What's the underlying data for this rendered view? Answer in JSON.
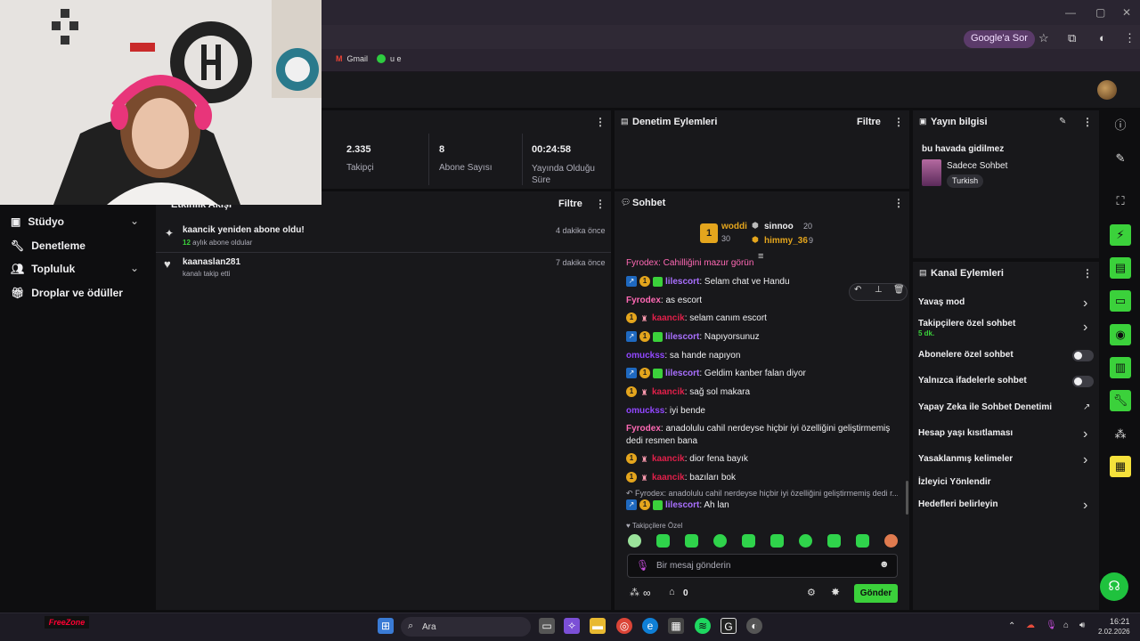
{
  "browser": {
    "ask_google": "Google'a Sor",
    "bookmarks": [
      {
        "label": "Gmail"
      },
      {
        "label": "u e"
      }
    ]
  },
  "nav": {
    "items": [
      {
        "label": "Stüdyo",
        "icon": "studio-icon",
        "has_chevron": true
      },
      {
        "label": "Denetleme",
        "icon": "wrench-icon",
        "has_chevron": false
      },
      {
        "label": "Topluluk",
        "icon": "community-icon",
        "has_chevron": true
      },
      {
        "label": "Droplar ve ödüller",
        "icon": "gift-icon",
        "has_chevron": false
      }
    ]
  },
  "stats": {
    "items": [
      {
        "value": "2.335",
        "label": "Takipçi"
      },
      {
        "value": "8",
        "label": "Abone Sayısı"
      },
      {
        "value": "00:24:58",
        "label": "Yayında Olduğu Süre"
      }
    ]
  },
  "activity": {
    "title": "Etkinlik Akışı",
    "filter": "Filtre",
    "events": [
      {
        "title": "kaancik yeniden abone oldu!",
        "detail_num": "12",
        "detail": " aylık abone oldular",
        "time": "4 dakika önce"
      },
      {
        "title": "kaanaslan281",
        "detail_num": "",
        "detail": "kanalı takip etti",
        "time": "7 dakika önce"
      }
    ]
  },
  "moderation": {
    "title": "Denetim Eylemleri",
    "filter": "Filtre"
  },
  "stream_info": {
    "title": "Yayın bilgisi",
    "stream_title": "bu havada gidilmez",
    "category": "Sadece Sohbet",
    "tag": "Turkish"
  },
  "chat": {
    "title": "Sohbet",
    "leaderboard": {
      "first": {
        "rank": "1",
        "name": "woddi",
        "score": "30"
      },
      "second": {
        "name": "sinnoo",
        "score": "20"
      },
      "third": {
        "name": "himmy_36",
        "score": "9"
      }
    },
    "partial_line": "Fyrodex: Cahilliğini mazur görün",
    "messages": [
      {
        "badges": [
          "prime",
          "one",
          "sub"
        ],
        "user": "lilescort",
        "color": "purple",
        "text": ": Selam chat ve Handu"
      },
      {
        "badges": [],
        "user": "Fyrodex",
        "color": "pink",
        "text": ": as escort"
      },
      {
        "badges": [
          "one",
          "gem"
        ],
        "user": "kaancik",
        "color": "red",
        "text": ": selam canım escort"
      },
      {
        "badges": [
          "prime",
          "one",
          "sub"
        ],
        "user": "lilescort",
        "color": "purple",
        "text": ": Napıyorsunuz"
      },
      {
        "badges": [],
        "user": "omuckss",
        "color": "violet",
        "text": ": sa hande napıyon"
      },
      {
        "badges": [
          "prime",
          "one",
          "sub"
        ],
        "user": "lilescort",
        "color": "purple",
        "text": ": Geldim kanber falan diyor"
      },
      {
        "badges": [
          "one",
          "gem"
        ],
        "user": "kaancik",
        "color": "red",
        "text": ": sağ sol makara"
      },
      {
        "badges": [],
        "user": "omuckss",
        "color": "violet",
        "text": ": iyi bende"
      },
      {
        "badges": [],
        "user": "Fyrodex",
        "color": "pink",
        "text": ": anadolulu cahil nerdeyse hiçbir iyi özelliğini geliştirmemiş dedi resmen bana"
      },
      {
        "badges": [
          "one",
          "gem"
        ],
        "user": "kaancik",
        "color": "red",
        "text": ": dior fena bayık"
      },
      {
        "badges": [
          "one",
          "gem"
        ],
        "user": "kaancik",
        "color": "red",
        "text": ": bazıları bok"
      }
    ],
    "reply_preview": "Fyrodex: anadolulu cahil nerdeyse hiçbir iyi özelliğini geliştirmemiş dedi r...",
    "last_message": {
      "user": "lilescort",
      "text": ": Ah lan"
    },
    "emote_label": "Takipçilere Özel",
    "input_placeholder": "Bir mesaj gönderin",
    "points": "∞",
    "store_count": "0",
    "send_label": "Gönder"
  },
  "channel_actions": {
    "title": "Kanal Eylemleri",
    "items": [
      {
        "label": "Yavaş mod",
        "sub": "",
        "control": "chevron"
      },
      {
        "label": "Takipçilere özel sohbet",
        "sub": "5 dk.",
        "control": "chevron"
      },
      {
        "label": "Abonelere özel sohbet",
        "sub": "",
        "control": "toggle"
      },
      {
        "label": "Yalnızca ifadelerle sohbet",
        "sub": "",
        "control": "toggle"
      },
      {
        "label": "Yapay Zeka ile Sohbet Denetimi",
        "sub": "",
        "control": "external"
      },
      {
        "label": "Hesap yaşı kısıtlaması",
        "sub": "",
        "control": "chevron"
      },
      {
        "label": "Yasaklanmış kelimeler",
        "sub": "",
        "control": "chevron"
      },
      {
        "label": "İzleyici Yönlendir",
        "sub": "",
        "control": "none"
      },
      {
        "label": "Hedefleri belirleyin",
        "sub": "",
        "control": "chevron"
      }
    ]
  },
  "taskbar": {
    "search": "Ara",
    "freezone": "FreeZone",
    "time": "16:21",
    "date": "2.02.2026"
  }
}
